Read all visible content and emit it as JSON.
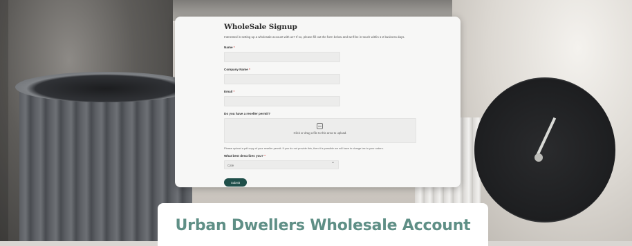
{
  "form": {
    "title": "WholeSale Signup",
    "intro": "Interested in setting up a wholesale account with us? If so, please fill out the form below and we'll be in touch within 1-2 business days.",
    "fields": {
      "name_label": "Name",
      "company_label": "Company Name",
      "email_label": "Email",
      "reseller_label": "Do you have a reseller permit?",
      "describe_label": "What best describes you?"
    },
    "required_mark": "*",
    "upload_text": "Click or drag a file to this area to upload.",
    "help_text": "Please upload a pdf copy of your reseller permit. If you do not provide this, then it is possible we will have to charge tax to your orders.",
    "select_value": "Cafe",
    "submit_label": "Submit"
  },
  "caption": {
    "text": "Urban Dwellers Wholesale Account"
  },
  "icons": {
    "upload": "upload-icon",
    "chevron": "chevron-down-icon"
  },
  "colors": {
    "caption_text": "#5f8f86",
    "submit_bg": "#1f4f4a",
    "required": "#d9534f"
  }
}
